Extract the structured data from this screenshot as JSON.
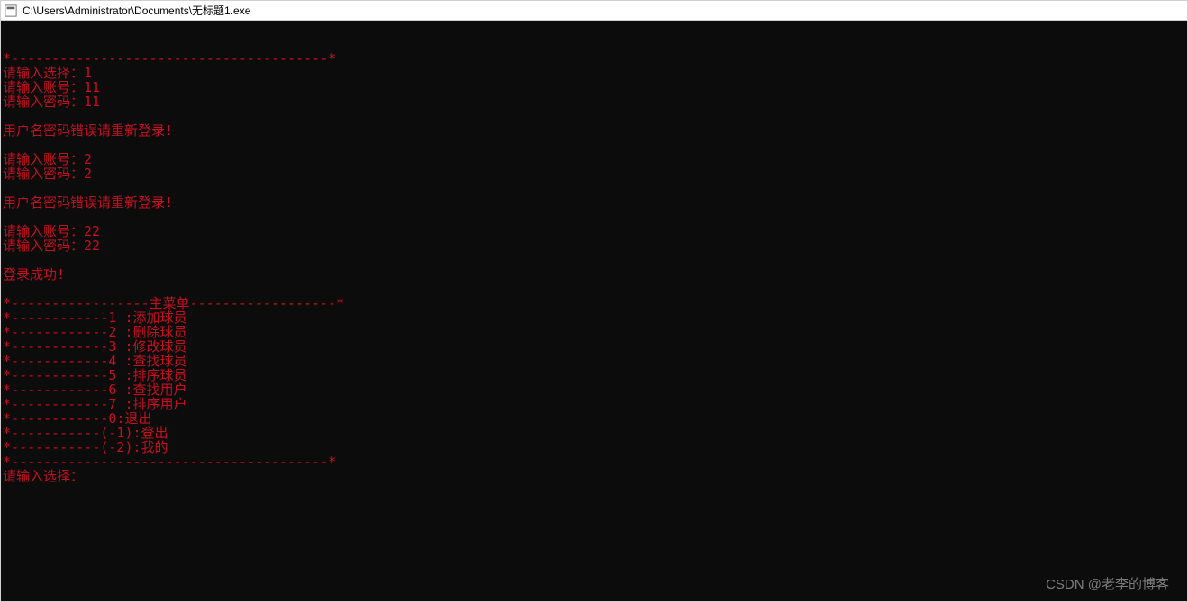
{
  "title_bar": {
    "path": "C:\\Users\\Administrator\\Documents\\无标题1.exe"
  },
  "console": {
    "lines": [
      "*---------------------------------------*",
      "请输入选择：1",
      "请输入账号：11",
      "请输入密码：11",
      "",
      "用户名密码错误请重新登录!",
      "",
      "请输入账号：2",
      "请输入密码：2",
      "",
      "用户名密码错误请重新登录!",
      "",
      "请输入账号：22",
      "请输入密码：22",
      "",
      "登录成功!",
      "",
      "*-----------------主菜单------------------*",
      "*------------1 :添加球员",
      "*------------2 :删除球员",
      "*------------3 :修改球员",
      "*------------4 :查找球员",
      "*------------5 :排序球员",
      "*------------6 :查找用户",
      "*------------7 :排序用户",
      "*------------0:退出",
      "*-----------(-1):登出",
      "*-----------(-2):我的",
      "*---------------------------------------*",
      "请输入选择："
    ]
  },
  "watermark": "CSDN @老李的博客"
}
